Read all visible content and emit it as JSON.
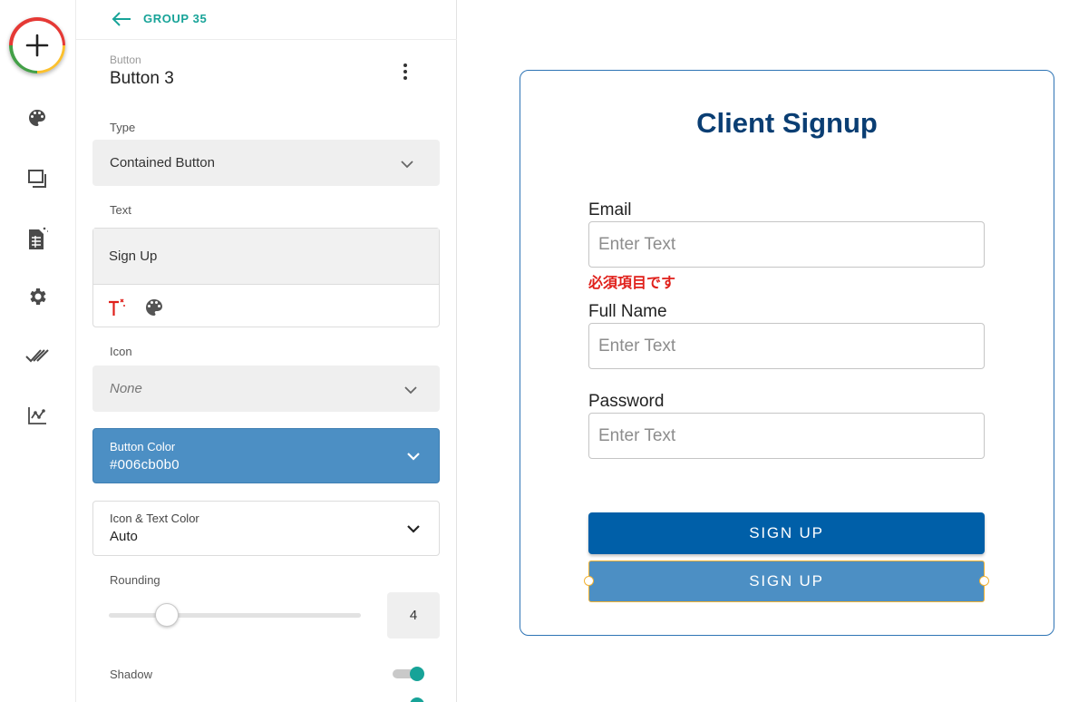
{
  "rail": {
    "items": [
      {
        "icon": "palette-icon"
      },
      {
        "icon": "layers-icon"
      },
      {
        "icon": "sheet-icon"
      },
      {
        "icon": "gear-icon"
      },
      {
        "icon": "double-check-icon"
      },
      {
        "icon": "analytics-icon"
      }
    ]
  },
  "panel": {
    "back_label": "GROUP 35",
    "component_type": "Button",
    "component_name": "Button 3",
    "type_label": "Type",
    "type_value": "Contained Button",
    "text_label": "Text",
    "text_value": "Sign Up",
    "icon_label": "Icon",
    "icon_value": "None",
    "button_color_label": "Button Color",
    "button_color_value": "#006cb0b0",
    "icon_text_color_label": "Icon & Text Color",
    "icon_text_color_value": "Auto",
    "rounding_label": "Rounding",
    "rounding_value": "4",
    "rounding_fraction": 0.23,
    "shadow_label": "Shadow",
    "shadow_enabled": true
  },
  "form": {
    "title": "Client Signup",
    "email_label": "Email",
    "email_placeholder": "Enter Text",
    "email_error": "必須項目です",
    "fullname_label": "Full Name",
    "fullname_placeholder": "Enter Text",
    "password_label": "Password",
    "password_placeholder": "Enter Text",
    "signup_button": "SIGN UP",
    "signup_button_selected": "SIGN UP"
  },
  "colors": {
    "accent": "#17a398",
    "primary_button": "#005fa8",
    "selected_button": "#4c8fc4",
    "selection_outline": "#f2b233",
    "title": "#0a3e73",
    "error": "#e0201b"
  }
}
